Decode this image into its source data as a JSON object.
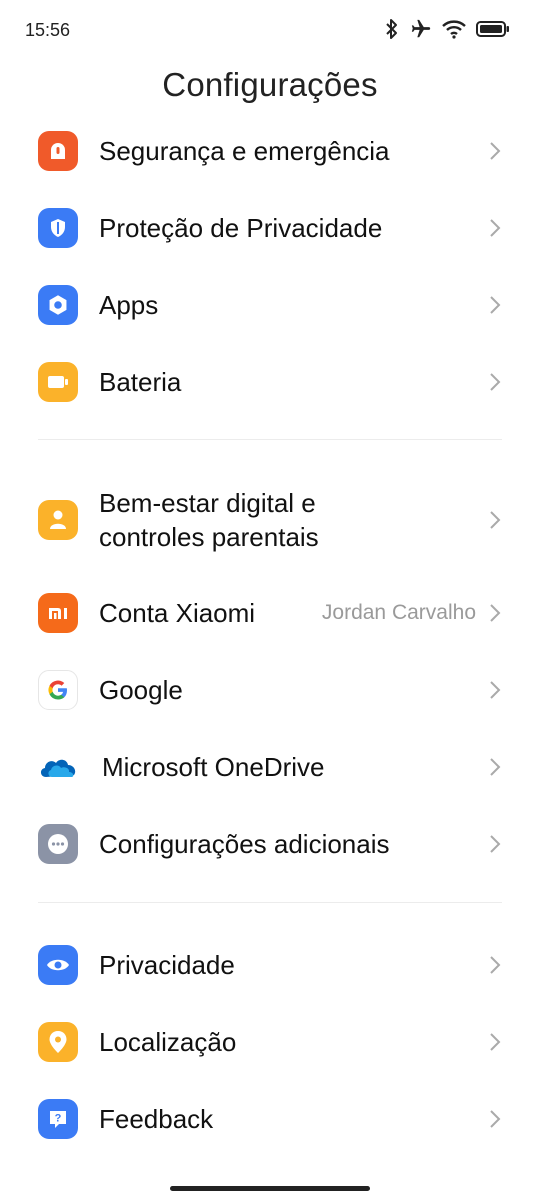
{
  "status_bar": {
    "time": "15:56"
  },
  "title": "Configurações",
  "groups": [
    [
      {
        "label": "Segurança e emergência",
        "icon": "sos-icon",
        "color": "#f05a2a"
      },
      {
        "label": "Proteção de Privacidade",
        "icon": "privacy-shield-icon",
        "color": "#3b7bf5"
      },
      {
        "label": "Apps",
        "icon": "apps-icon",
        "color": "#3b7bf5"
      },
      {
        "label": "Bateria",
        "icon": "battery-icon",
        "color": "#fbb22a"
      }
    ],
    [
      {
        "label_line1": "Bem-estar digital e",
        "label_line2": "controles parentais",
        "icon": "wellbeing-icon",
        "color": "#fbb22a"
      },
      {
        "label": "Conta Xiaomi",
        "value": "Jordan Carvalho",
        "icon": "xiaomi-icon",
        "color": "#f56a1a"
      },
      {
        "label": "Google",
        "icon": "google-icon",
        "color": "#ffffff"
      },
      {
        "label": "Microsoft OneDrive",
        "icon": "onedrive-icon",
        "color": "#0f78d4"
      },
      {
        "label": "Configurações adicionais",
        "icon": "more-icon",
        "color": "#8b93a6"
      }
    ],
    [
      {
        "label": "Privacidade",
        "icon": "eye-icon",
        "color": "#3b7bf5"
      },
      {
        "label": "Localização",
        "icon": "location-pin-icon",
        "color": "#fbb22a"
      },
      {
        "label": "Feedback",
        "icon": "feedback-icon",
        "color": "#3b7bf5"
      }
    ]
  ]
}
